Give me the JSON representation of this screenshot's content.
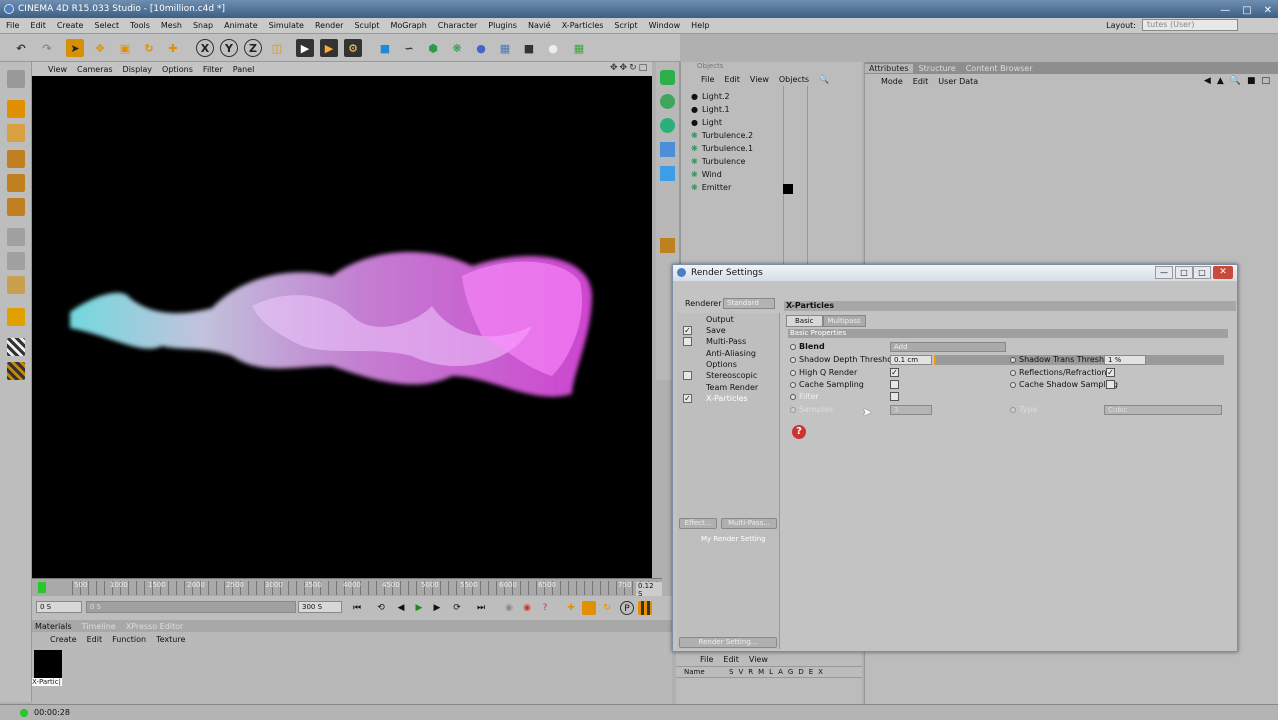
{
  "app": {
    "title": "CINEMA 4D R15.033 Studio - [10million.c4d *]"
  },
  "menu": [
    "File",
    "Edit",
    "Create",
    "Select",
    "Tools",
    "Mesh",
    "Snap",
    "Animate",
    "Simulate",
    "Render",
    "Sculpt",
    "MoGraph",
    "Character",
    "Plugins",
    "Navié",
    "X-Particles",
    "Script",
    "Window",
    "Help"
  ],
  "layout": {
    "label": "Layout:",
    "value": "tutes (User)"
  },
  "viewport_menu": [
    "View",
    "Cameras",
    "Display",
    "Options",
    "Filter",
    "Panel"
  ],
  "timeline": {
    "ticks": [
      "500",
      "1000",
      "1500",
      "2000",
      "2500",
      "3000",
      "3500",
      "4000",
      "4500",
      "5000",
      "5500",
      "6000",
      "6500",
      "750"
    ],
    "current": "0.12 S",
    "start": "0 S",
    "end": "300 S",
    "range_a": "0 S",
    "range_b": "300 S"
  },
  "materials": {
    "tabs": [
      "Materials",
      "Timeline",
      "XPresso Editor"
    ],
    "menu": [
      "Create",
      "Edit",
      "Function",
      "Texture"
    ],
    "item_label": "X-Partic|"
  },
  "status": {
    "time": "00:00:28"
  },
  "objects": {
    "tab": "Objects",
    "menu": [
      "File",
      "Edit",
      "View",
      "Objects"
    ],
    "items": [
      "Light.2",
      "Light.1",
      "Light",
      "Turbulence.2",
      "Turbulence.1",
      "Turbulence",
      "Wind",
      "Emitter"
    ]
  },
  "attributes": {
    "tabs": [
      "Attributes",
      "Structure",
      "Content Browser"
    ],
    "menu": [
      "Mode",
      "Edit",
      "User Data"
    ]
  },
  "layers": {
    "menu": [
      "File",
      "Edit",
      "View"
    ],
    "header": "Name",
    "cols": [
      "S",
      "V",
      "R",
      "M",
      "L",
      "A",
      "G",
      "D",
      "E",
      "X"
    ]
  },
  "render_settings": {
    "title": "Render Settings",
    "renderer_label": "Renderer",
    "renderer_value": "Standard",
    "items": [
      {
        "label": "Output",
        "checked": null
      },
      {
        "label": "Save",
        "checked": true
      },
      {
        "label": "Multi-Pass",
        "checked": false
      },
      {
        "label": "Anti-Aliasing",
        "checked": null
      },
      {
        "label": "Options",
        "checked": null
      },
      {
        "label": "Stereoscopic",
        "checked": false
      },
      {
        "label": "Team Render",
        "checked": null
      },
      {
        "label": "X-Particles",
        "checked": true
      }
    ],
    "effect_btn": "Effect...",
    "multipass_btn": "Multi-Pass...",
    "setting_name": "My Render Setting",
    "render_setting_btn": "Render Setting...",
    "panel_title": "X-Particles",
    "subtabs": [
      "Basic",
      "Multipass"
    ],
    "section": "Basic Properties",
    "blend": {
      "label": "Blend",
      "value": "Add"
    },
    "shadow_depth": {
      "label": "Shadow Depth Threshold",
      "value": "0.1 cm"
    },
    "shadow_trans": {
      "label": "Shadow Trans Threshold",
      "value": "1 %"
    },
    "high_q": {
      "label": "High Q Render",
      "checked": true
    },
    "reflections": {
      "label": "Reflections/Refraction",
      "checked": true
    },
    "cache_sampling": {
      "label": "Cache Sampling",
      "checked": false
    },
    "cache_shadow": {
      "label": "Cache Shadow Sampling",
      "checked": false
    },
    "filter": {
      "label": "Filter",
      "checked": false
    },
    "samples": {
      "label": "Samples",
      "value": "3"
    },
    "type": {
      "label": "Type",
      "value": "Cubic"
    }
  },
  "colors": {
    "accent_orange": "#e8a000",
    "x_particles_cyan": "#79e6f2",
    "x_particles_magenta": "#e85ee8"
  }
}
